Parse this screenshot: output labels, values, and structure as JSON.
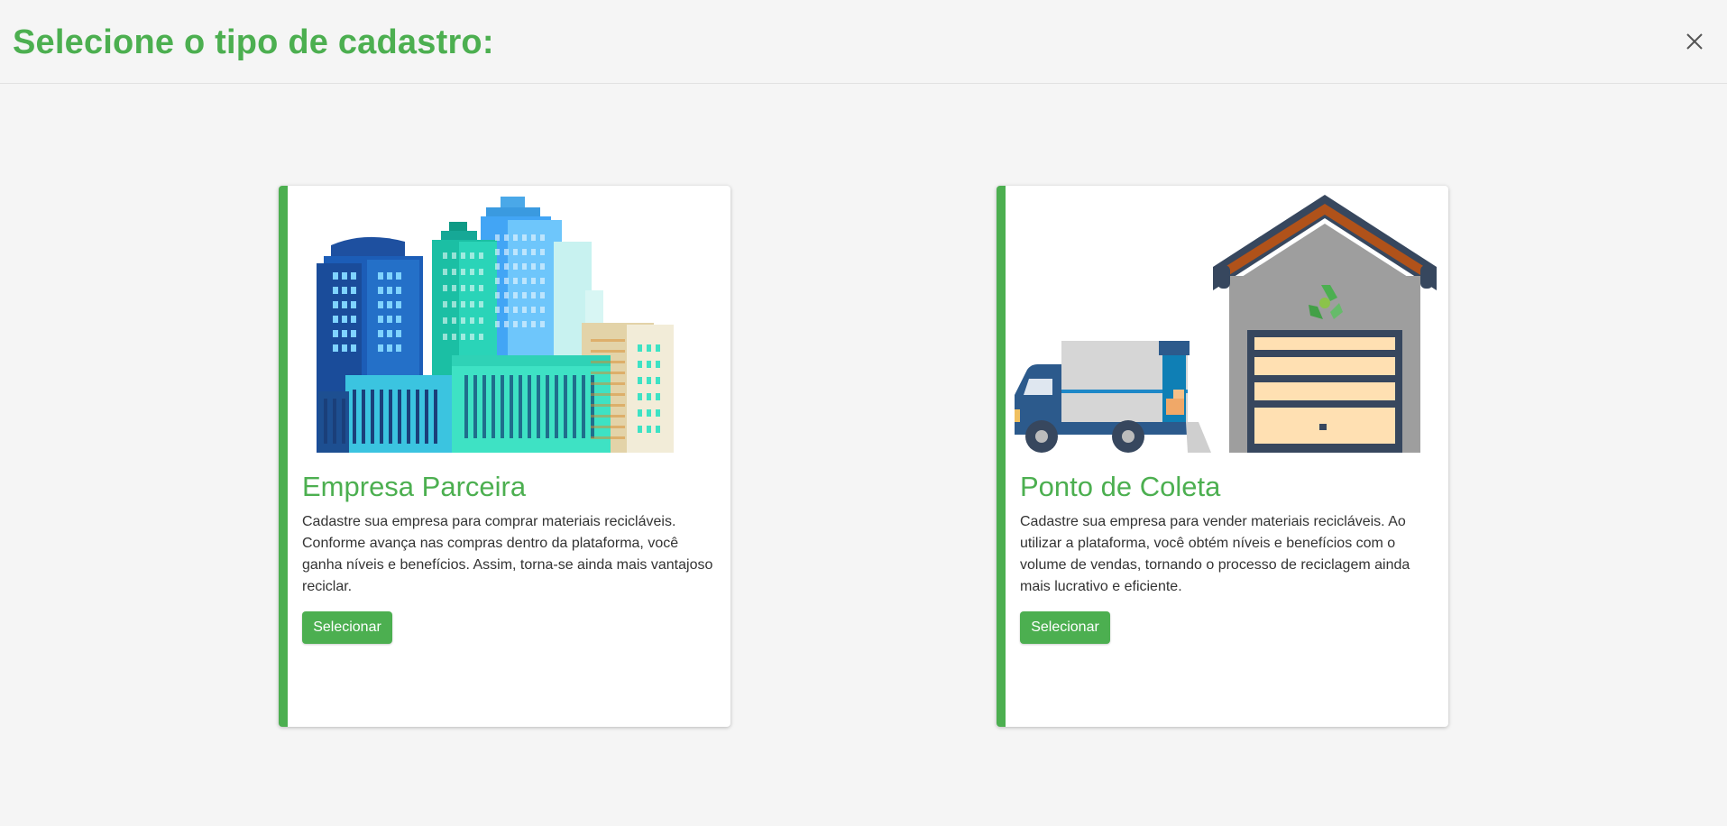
{
  "modal": {
    "title": "Selecione o tipo de cadastro:",
    "close_icon": "close-icon"
  },
  "cards": [
    {
      "title": "Empresa Parceira",
      "description": "Cadastre sua empresa para comprar materiais recicláveis. Conforme avança nas compras dentro da plataforma, você ganha níveis e benefícios. Assim, torna-se ainda mais vantajoso reciclar.",
      "button": "Selecionar",
      "illustration": "city-buildings-illustration"
    },
    {
      "title": "Ponto de Coleta",
      "description": "Cadastre sua empresa para vender materiais recicláveis. Ao utilizar a plataforma, você obtém níveis e benefícios com o volume de vendas, tornando o processo de reciclagem ainda mais lucrativo e eficiente.",
      "button": "Selecionar",
      "illustration": "truck-warehouse-illustration"
    }
  ],
  "colors": {
    "accent": "#4caf50",
    "background": "#f5f5f5"
  }
}
